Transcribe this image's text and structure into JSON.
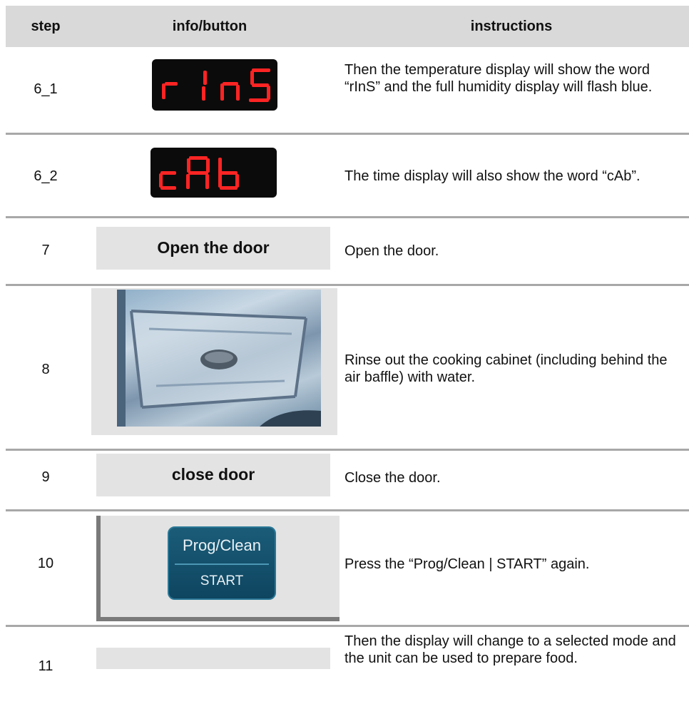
{
  "header": {
    "step": "step",
    "info": "info/button",
    "instructions": "instructions"
  },
  "rows": [
    {
      "step": "6_1",
      "display_text": "rInS",
      "instructions": "Then the temperature display will show the word “rInS” and the full humidity display will flash blue."
    },
    {
      "step": "6_2",
      "display_text": "cAb",
      "instructions": "The time display will also show the word “cAb”."
    },
    {
      "step": "7",
      "button_label": "Open the door",
      "instructions": "Open the door."
    },
    {
      "step": "8",
      "image": "cooking-cabinet-photo",
      "instructions": "Rinse out the cooking cabinet (including behind the air baffle) with water."
    },
    {
      "step": "9",
      "button_label": "close door",
      "instructions": "Close the door."
    },
    {
      "step": "10",
      "button_top": "Prog/Clean",
      "button_bottom": "START",
      "instructions": "Press the “Prog/Clean | START” again."
    },
    {
      "step": "11",
      "instructions": "Then the display will change to a selected mode and the unit can be used to prepare food."
    }
  ],
  "colors": {
    "header_bg": "#d9d9d9",
    "panel_bg": "#e3e3e3",
    "led_red": "#ff1e1e",
    "button_teal": "#1b5c78"
  }
}
